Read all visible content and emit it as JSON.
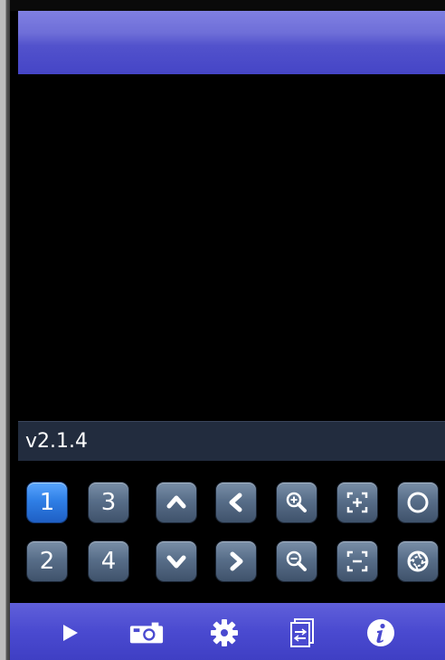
{
  "version": {
    "text": "v2.1.4"
  },
  "channels": {
    "row1": [
      "1",
      "3"
    ],
    "row2": [
      "2",
      "4"
    ],
    "active": "1"
  },
  "ptz_icons": [
    "arrow-up-icon",
    "arrow-left-icon",
    "zoom-in-icon",
    "focus-near-icon",
    "iris-open-icon",
    "arrow-down-icon",
    "arrow-right-icon",
    "zoom-out-icon",
    "focus-far-icon",
    "iris-close-icon"
  ],
  "bottom_nav": [
    "play-icon",
    "camera-icon",
    "gear-icon",
    "switch-view-icon",
    "info-icon"
  ],
  "colors": {
    "title_bar": "#5a5ad0",
    "button": "#586e89",
    "active_button": "#2f7fe6",
    "bottom_bar": "#4a4ad0",
    "version_bar": "#222c3e"
  }
}
